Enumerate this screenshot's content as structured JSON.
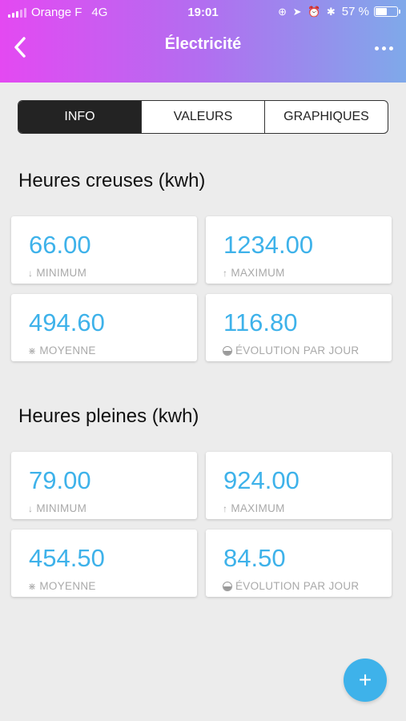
{
  "status_bar": {
    "carrier": "Orange F",
    "network": "4G",
    "time": "19:01",
    "battery_text": "57 %",
    "battery_level": 0.57
  },
  "nav": {
    "title": "Électricité"
  },
  "tabs": [
    {
      "label": "INFO",
      "active": true
    },
    {
      "label": "VALEURS",
      "active": false
    },
    {
      "label": "GRAPHIQUES",
      "active": false
    }
  ],
  "sections": [
    {
      "title": "Heures creuses (kwh)",
      "cards": [
        {
          "value": "66.00",
          "label": "MINIMUM",
          "icon": "arrow-down-icon"
        },
        {
          "value": "1234.00",
          "label": "MAXIMUM",
          "icon": "arrow-up-icon"
        },
        {
          "value": "494.60",
          "label": "MOYENNE",
          "icon": "average-icon"
        },
        {
          "value": "116.80",
          "label": "ÉVOLUTION PAR JOUR",
          "icon": "gauge-icon"
        }
      ]
    },
    {
      "title": "Heures pleines (kwh)",
      "cards": [
        {
          "value": "79.00",
          "label": "MINIMUM",
          "icon": "arrow-down-icon"
        },
        {
          "value": "924.00",
          "label": "MAXIMUM",
          "icon": "arrow-up-icon"
        },
        {
          "value": "454.50",
          "label": "MOYENNE",
          "icon": "average-icon"
        },
        {
          "value": "84.50",
          "label": "ÉVOLUTION PAR JOUR",
          "icon": "gauge-icon"
        }
      ]
    }
  ],
  "fab": {
    "label": "+"
  },
  "colors": {
    "accent": "#3eb2ea",
    "header_gradient_start": "#e449f2",
    "header_gradient_end": "#7fa9ea"
  }
}
